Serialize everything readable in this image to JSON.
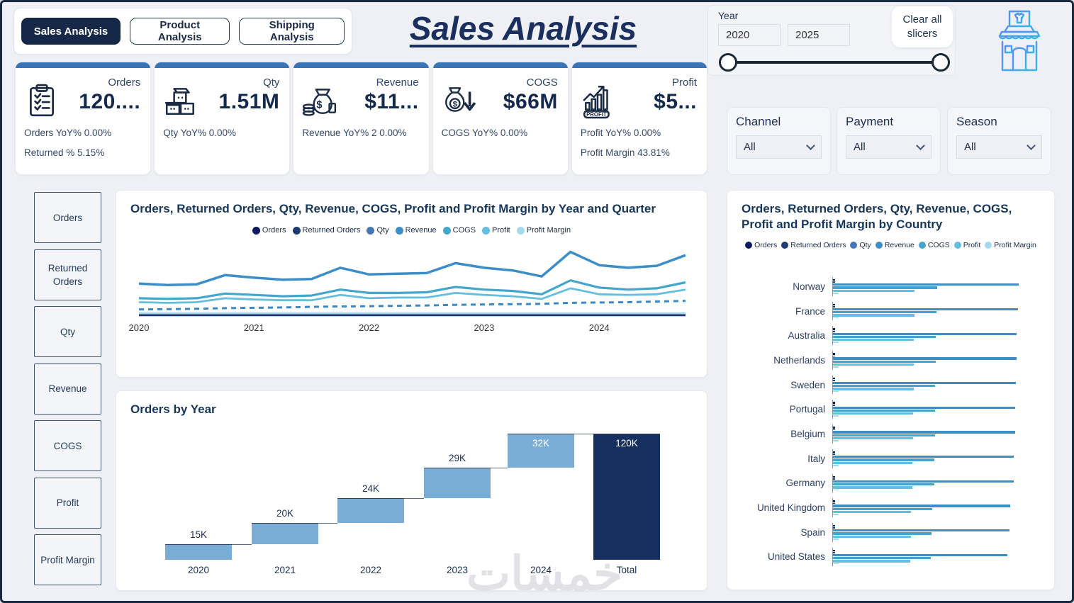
{
  "app": {
    "title": "Sales Analysis",
    "watermark": "خمسات"
  },
  "tabs": [
    {
      "label": "Sales Analysis",
      "active": true
    },
    {
      "label": "Product Analysis",
      "active": false
    },
    {
      "label": "Shipping Analysis",
      "active": false
    }
  ],
  "year_slicer": {
    "label": "Year",
    "start": "2020",
    "end": "2025"
  },
  "clear_button_label": "Clear all slicers",
  "kpis": [
    {
      "name": "Orders",
      "value": "120....",
      "icon": "clipboard-checklist",
      "lines": [
        "Orders YoY% 0.00%",
        "Returned % 5.15%"
      ]
    },
    {
      "name": "Qty",
      "value": "1.51M",
      "icon": "boxes",
      "lines": [
        "Qty YoY% 0.00%"
      ]
    },
    {
      "name": "Revenue",
      "value": "$11...",
      "icon": "money-bag",
      "lines": [
        "Revenue YoY% 2 0.00%"
      ]
    },
    {
      "name": "COGS",
      "value": "$66M",
      "icon": "money-bag-arrow-down",
      "lines": [
        "COGS YoY% 0.00%"
      ]
    },
    {
      "name": "Profit",
      "value": "$5...",
      "icon": "profit-growth",
      "lines": [
        "Profit YoY% 0.00%",
        "Profit Margin 43.81%"
      ]
    }
  ],
  "filters": [
    {
      "label": "Channel",
      "value": "All"
    },
    {
      "label": "Payment",
      "value": "All"
    },
    {
      "label": "Season",
      "value": "All"
    }
  ],
  "sidebar": {
    "items": [
      "Orders",
      "Returned Orders",
      "Qty",
      "Revenue",
      "COGS",
      "Profit",
      "Profit Margin"
    ]
  },
  "legend": {
    "items": [
      "Orders",
      "Returned Orders",
      "Qty",
      "Revenue",
      "COGS",
      "Profit",
      "Profit Margin"
    ],
    "colors": [
      "#0d1b5e",
      "#1e3a74",
      "#4577b5",
      "#3d8ec6",
      "#45a5cd",
      "#64bede",
      "#a5d9ed"
    ]
  },
  "colors": {
    "accent": "#3a74b4",
    "navy": "#152848",
    "panel_border": "#e8eaf0"
  },
  "chart_data": [
    {
      "id": "trend-by-year-quarter",
      "type": "line",
      "title": "Orders, Returned Orders, Qty, Revenue, COGS, Profit and Profit Margin by Year and Quarter",
      "x_unit": "quarter",
      "x_tick_labels": [
        "2020",
        "2021",
        "2022",
        "2023",
        "2024"
      ],
      "ylim": [
        0,
        10.5
      ],
      "grid": false,
      "legend_position": "top-center",
      "series": [
        {
          "name": "Orders",
          "color": "#0d1b5e",
          "style": "solid",
          "width": 1.5,
          "values": [
            0.3,
            0.3,
            0.3,
            0.3,
            0.3,
            0.3,
            0.3,
            0.3,
            0.3,
            0.3,
            0.3,
            0.3,
            0.3,
            0.3,
            0.3,
            0.3,
            0.3,
            0.3,
            0.3,
            0.3
          ]
        },
        {
          "name": "Returned Orders",
          "color": "#1e3a74",
          "style": "solid",
          "width": 1.2,
          "values": [
            0.15,
            0.15,
            0.15,
            0.15,
            0.15,
            0.15,
            0.15,
            0.15,
            0.15,
            0.15,
            0.15,
            0.15,
            0.15,
            0.15,
            0.15,
            0.15,
            0.15,
            0.15,
            0.15,
            0.15
          ]
        },
        {
          "name": "Qty",
          "color": "#3d87c3",
          "style": "dashed",
          "width": 3,
          "values": [
            1.1,
            1.15,
            1.2,
            1.3,
            1.35,
            1.4,
            1.5,
            1.55,
            1.6,
            1.65,
            1.7,
            1.8,
            1.85,
            1.9,
            1.95,
            2.1,
            2.15,
            2.2,
            2.3,
            2.4
          ]
        },
        {
          "name": "Revenue",
          "color": "#3d8ec6",
          "style": "solid",
          "width": 3.5,
          "values": [
            5.0,
            4.8,
            4.9,
            6.3,
            5.9,
            5.6,
            5.7,
            7.4,
            6.4,
            6.5,
            6.6,
            8.1,
            7.4,
            7.0,
            6.1,
            9.8,
            7.8,
            7.4,
            7.7,
            9.3
          ]
        },
        {
          "name": "COGS",
          "color": "#45a5cd",
          "style": "solid",
          "width": 3.2,
          "values": [
            2.8,
            2.7,
            2.8,
            3.5,
            3.3,
            3.1,
            3.2,
            4.1,
            3.6,
            3.6,
            3.7,
            4.5,
            4.1,
            3.9,
            3.4,
            5.5,
            4.4,
            4.1,
            4.3,
            5.2
          ]
        },
        {
          "name": "Profit",
          "color": "#64bede",
          "style": "solid",
          "width": 2.8,
          "values": [
            2.2,
            2.1,
            2.2,
            2.8,
            2.6,
            2.5,
            2.5,
            3.3,
            2.8,
            2.9,
            2.9,
            3.6,
            3.3,
            3.1,
            2.7,
            4.3,
            3.4,
            3.3,
            3.4,
            4.1
          ]
        },
        {
          "name": "Profit Margin",
          "color": "#a5d9ed",
          "style": "solid",
          "width": 2.5,
          "values": [
            0.55,
            0.55,
            0.55,
            0.55,
            0.55,
            0.55,
            0.55,
            0.55,
            0.55,
            0.55,
            0.55,
            0.55,
            0.55,
            0.55,
            0.55,
            0.55,
            0.55,
            0.55,
            0.55,
            0.55
          ]
        }
      ]
    },
    {
      "id": "orders-by-year",
      "type": "bar",
      "subtype": "waterfall",
      "title": "Orders by Year",
      "categories": [
        "2020",
        "2021",
        "2022",
        "2023",
        "2024",
        "Total"
      ],
      "values": [
        15000,
        20000,
        24000,
        29000,
        32000,
        120000
      ],
      "labels": [
        "15K",
        "20K",
        "24K",
        "29K",
        "32K",
        "120K"
      ],
      "bar_color": "#7aadd6",
      "total_color": "#16305f",
      "ylim": [
        0,
        120000
      ]
    },
    {
      "id": "metrics-by-country",
      "type": "bar",
      "orientation": "horizontal",
      "title": "Orders, Returned Orders, Qty, Revenue, COGS, Profit and Profit Margin by Country",
      "categories": [
        "Norway",
        "France",
        "Australia",
        "Netherlands",
        "Sweden",
        "Portugal",
        "Belgium",
        "Italy",
        "Germany",
        "United Kingdom",
        "Spain",
        "United States"
      ],
      "value_scale": "relative",
      "series": [
        {
          "name": "Revenue",
          "color": "#3d8ec6",
          "values": [
            1.0,
            0.995,
            0.99,
            0.99,
            0.985,
            0.98,
            0.98,
            0.975,
            0.975,
            0.955,
            0.95,
            0.94
          ]
        },
        {
          "name": "COGS",
          "color": "#44a3cd",
          "values": [
            0.56,
            0.557,
            0.554,
            0.554,
            0.551,
            0.549,
            0.549,
            0.546,
            0.546,
            0.535,
            0.532,
            0.526
          ]
        },
        {
          "name": "Profit",
          "color": "#63bfdf",
          "values": [
            0.44,
            0.438,
            0.436,
            0.436,
            0.434,
            0.431,
            0.431,
            0.429,
            0.429,
            0.42,
            0.418,
            0.414
          ]
        }
      ]
    }
  ]
}
